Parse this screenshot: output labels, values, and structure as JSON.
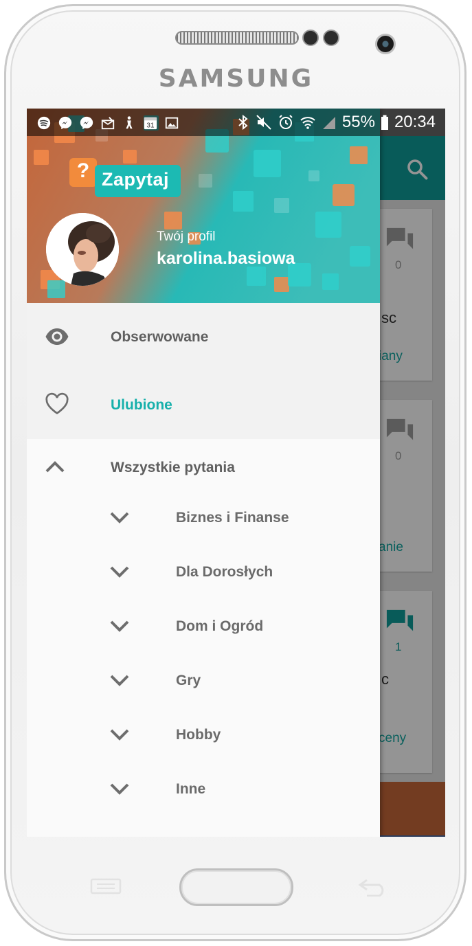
{
  "device": {
    "brand": "SAMSUNG"
  },
  "status_bar": {
    "battery": "55%",
    "time": "20:34",
    "calendar_day": "31",
    "left_icons": [
      "spotify-icon",
      "messenger-icon",
      "messenger-icon",
      "mail-icon",
      "accessibility-icon",
      "calendar-icon",
      "gallery-icon"
    ],
    "right_icons": [
      "bluetooth-icon",
      "mute-icon",
      "alarm-icon",
      "wifi-icon",
      "signal-icon",
      "battery-icon"
    ]
  },
  "header": {
    "logo_text": "Zapytaj",
    "logo_mark": "?",
    "profile_label": "Twój profil",
    "username": "karolina.basiowa"
  },
  "menu": {
    "items": [
      {
        "icon": "eye-icon",
        "label": "Obserwowane",
        "active": false
      },
      {
        "icon": "heart-icon",
        "label": "Ulubione",
        "active": true
      },
      {
        "icon": "chevron-up-icon",
        "label": "Wszystkie pytania",
        "active": false
      }
    ],
    "categories": [
      {
        "icon": "chevron-down-icon",
        "label": "Biznes i Finanse"
      },
      {
        "icon": "chevron-down-icon",
        "label": "Dla Dorosłych"
      },
      {
        "icon": "chevron-down-icon",
        "label": "Dom i Ogród"
      },
      {
        "icon": "chevron-down-icon",
        "label": "Gry"
      },
      {
        "icon": "chevron-down-icon",
        "label": "Hobby"
      },
      {
        "icon": "chevron-down-icon",
        "label": "Inne"
      }
    ]
  },
  "background_app": {
    "cards": [
      {
        "answers": "0",
        "text_fragment": "sc",
        "link_fragment": "iany"
      },
      {
        "answers": "0",
        "text_fragment": "",
        "link_fragment": "anie"
      },
      {
        "answers": "1",
        "text_fragment": "c",
        "link_fragment": "ceny"
      }
    ]
  },
  "colors": {
    "accent": "#17b0ab",
    "toolbar": "#0f9e99",
    "header_orange": "#c9733f",
    "logo_teal": "#1cbab3"
  }
}
